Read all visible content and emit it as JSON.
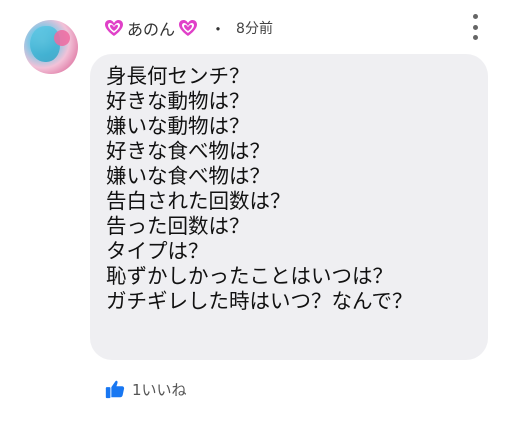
{
  "comment": {
    "author": "あのん",
    "separator": "・",
    "timestamp": "8分前",
    "lines": [
      "身長何センチ？",
      "好きな動物は？",
      "嫌いな動物は？",
      "好きな食べ物は？",
      "嫌いな食べ物は？",
      "告白された回数は？",
      "告った回数は？",
      "タイプは？",
      "恥ずかしかったことはいつは？",
      "ガチギレした時はいつ？なんで？"
    ],
    "likes_label": "1いいね"
  },
  "colors": {
    "heart": "#e040c8",
    "like": "#1877f2",
    "bubble": "#efeff2"
  },
  "icons": {
    "avatar": "user-avatar",
    "heart": "heart-icon",
    "menu": "more-vert-icon",
    "like": "thumbs-up-icon"
  }
}
